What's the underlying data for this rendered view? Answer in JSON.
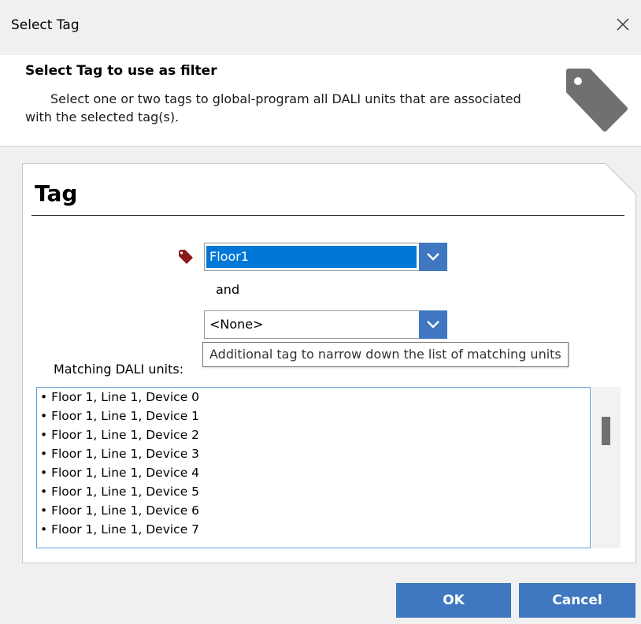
{
  "window": {
    "title": "Select Tag"
  },
  "header": {
    "title": "Select Tag to use as filter",
    "description": "Select one or two tags to global-program all DALI units that are associated with the selected tag(s).",
    "icon": "tag-icon"
  },
  "panel": {
    "heading": "Tag",
    "tag1": {
      "value": "Floor1"
    },
    "connector": "and",
    "tag2": {
      "value": "<None>"
    },
    "tooltip": "Additional tag to narrow down the list of matching units",
    "matching_label": "Matching DALI units:",
    "matching_units": [
      "• Floor 1, Line 1, Device 0",
      "• Floor 1, Line 1, Device 1",
      "• Floor 1, Line 1, Device 2",
      "• Floor 1, Line 1, Device 3",
      "• Floor 1, Line 1, Device 4",
      "• Floor 1, Line 1, Device 5",
      "• Floor 1, Line 1, Device 6",
      "• Floor 1, Line 1, Device 7"
    ]
  },
  "buttons": {
    "ok": "OK",
    "cancel": "Cancel"
  },
  "colors": {
    "accent": "#3f78c0",
    "selection": "#0078d7",
    "small_tag": "#8b1a1a",
    "big_tag": "#707070"
  }
}
